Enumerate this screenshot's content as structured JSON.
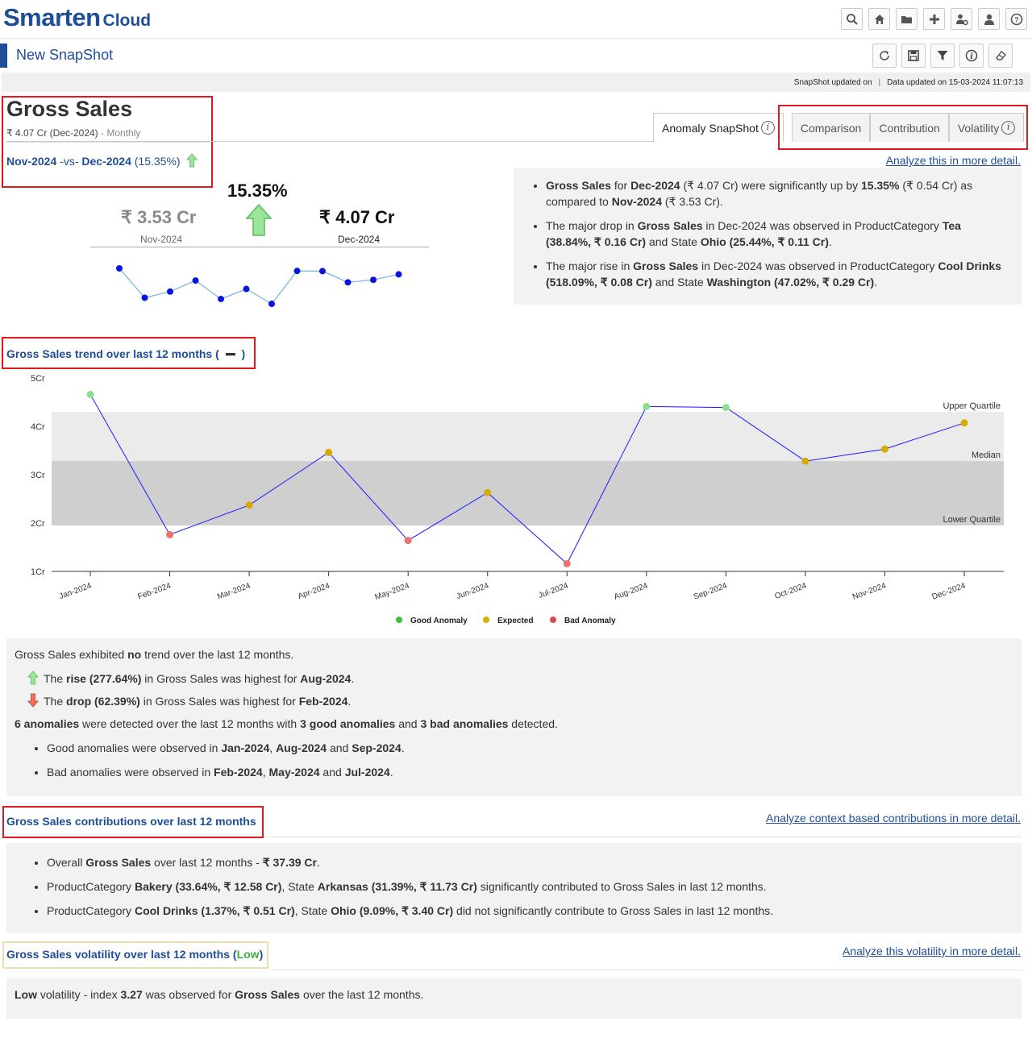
{
  "app": {
    "logo_main": "Smarten",
    "logo_sub": "Cloud"
  },
  "top_icons": [
    "search-icon",
    "home-icon",
    "folder-icon",
    "plus-icon",
    "user-settings-icon",
    "user-icon",
    "help-icon"
  ],
  "page": {
    "title": "New SnapShot"
  },
  "sub_icons": [
    "refresh-icon",
    "save-icon",
    "filter-icon",
    "info-icon",
    "eraser-icon"
  ],
  "status": {
    "snapshot_label": "SnapShot updated on",
    "separator": "|",
    "data_label": "Data updated on 15-03-2024 11:07:13"
  },
  "measure": {
    "title": "Gross Sales",
    "current_value": "₹ 4.07 Cr (Dec-2024)",
    "frequency": "- Monthly",
    "compare_prev": "Nov-2024",
    "compare_vs": "-vs-",
    "compare_cur": "Dec-2024",
    "compare_pct": "(15.35%)"
  },
  "tabs": [
    {
      "label": "Anomaly SnapShot",
      "active": true,
      "info": "i"
    },
    {
      "label": "Comparison",
      "active": false
    },
    {
      "label": "Contribution",
      "active": false
    },
    {
      "label": "Volatility",
      "active": false,
      "info": "i"
    }
  ],
  "links": {
    "analyze_detail": "Analyze this in more detail.",
    "analyze_contrib": "Analyze context based contributions in more detail.",
    "analyze_vol": "Analyze this volatility in more detail."
  },
  "kpi": {
    "pct": "15.35%",
    "prev_value": "₹ 3.53 Cr",
    "prev_label": "Nov-2024",
    "cur_value": "₹ 4.07 Cr",
    "cur_label": "Dec-2024",
    "sparkline": [
      4.66,
      1.76,
      2.37,
      3.46,
      1.64,
      2.63,
      1.16,
      4.41,
      4.39,
      3.28,
      3.53,
      4.07
    ]
  },
  "summary": {
    "b1": {
      "a": "Gross Sales",
      "b": " for ",
      "c": "Dec-2024",
      "d": " (₹ 4.07 Cr) were significantly up by ",
      "e": "15.35%",
      "f": " (₹ 0.54 Cr) as compared to ",
      "g": "Nov-2024",
      "h": " (₹ 3.53 Cr)."
    },
    "b2": {
      "a": "The major drop in ",
      "b": "Gross Sales",
      "c": " in Dec-2024 was observed in ProductCategory ",
      "d": "Tea (38.84%, ₹ 0.16 Cr)",
      "e": " and State ",
      "f": "Ohio (25.44%, ₹ 0.11 Cr)",
      "g": "."
    },
    "b3": {
      "a": "The major rise in ",
      "b": "Gross Sales",
      "c": " in Dec-2024 was observed in ProductCategory ",
      "d": "Cool Drinks (518.09%, ₹ 0.08 Cr)",
      "e": " and State ",
      "f": "Washington (47.02%, ₹ 0.29 Cr)",
      "g": "."
    }
  },
  "trend_section": {
    "title": "Gross Sales trend over last 12 months (",
    "title_end": ")"
  },
  "chart_data": {
    "type": "line",
    "categories": [
      "Jan-2024",
      "Feb-2024",
      "Mar-2024",
      "Apr-2024",
      "May-2024",
      "Jun-2024",
      "Jul-2024",
      "Aug-2024",
      "Sep-2024",
      "Oct-2024",
      "Nov-2024",
      "Dec-2024"
    ],
    "values": [
      4.66,
      1.76,
      2.37,
      3.46,
      1.64,
      2.63,
      1.16,
      4.41,
      4.39,
      3.28,
      3.53,
      4.07
    ],
    "point_class": [
      "good",
      "bad",
      "expected",
      "expected",
      "bad",
      "expected",
      "bad",
      "good",
      "good",
      "expected",
      "expected",
      "expected"
    ],
    "y_ticks": [
      "1Cr",
      "2Cr",
      "3Cr",
      "4Cr",
      "5Cr"
    ],
    "ylim": [
      1,
      5
    ],
    "bands": {
      "upper_quartile": 4.3,
      "median": 3.28,
      "lower_quartile": 1.95
    },
    "band_labels": {
      "upper": "Upper Quartile",
      "median": "Median",
      "lower": "Lower Quartile"
    },
    "legend": [
      {
        "name": "Good Anomaly",
        "color": "#3cc13c"
      },
      {
        "name": "Expected",
        "color": "#d9aa00"
      },
      {
        "name": "Bad Anomaly",
        "color": "#e04848"
      }
    ],
    "colors": {
      "line": "#1a1aff",
      "good": "#8be08b",
      "expected": "#d9aa00",
      "bad": "#f07070",
      "band_outer": "#ebebeb",
      "band_inner": "#cfcfcf"
    }
  },
  "trend_summary": {
    "l1a": "Gross Sales exhibited ",
    "l1b": "no",
    "l1c": " trend over the last 12 months.",
    "l2a": "The ",
    "l2b": "rise (277.64%)",
    "l2c": " in Gross Sales was highest for ",
    "l2d": "Aug-2024",
    "l2e": ".",
    "l3a": "The ",
    "l3b": "drop (62.39%)",
    "l3c": " in Gross Sales was highest for ",
    "l3d": "Feb-2024",
    "l3e": ".",
    "l4a": "6 anomalies",
    "l4b": " were detected over the last 12 months with ",
    "l4c": "3 good anomalies",
    "l4d": " and ",
    "l4e": "3 bad anomalies",
    "l4f": " detected.",
    "g1": "Good anomalies were observed in ",
    "g2": "Jan-2024",
    "g3": ", ",
    "g4": "Aug-2024",
    "g5": " and ",
    "g6": "Sep-2024",
    "g7": ".",
    "b1": "Bad anomalies were observed in ",
    "b2": "Feb-2024",
    "b3": ", ",
    "b4": "May-2024",
    "b5": " and ",
    "b6": "Jul-2024",
    "b7": "."
  },
  "contrib_section": {
    "title": "Gross Sales contributions over last 12 months"
  },
  "contrib": {
    "c1a": "Overall ",
    "c1b": "Gross Sales",
    "c1c": " over last 12 months - ",
    "c1d": "₹ 37.39 Cr",
    "c1e": ".",
    "c2a": "ProductCategory ",
    "c2b": "Bakery (33.64%, ₹ 12.58 Cr)",
    "c2c": ", State ",
    "c2d": "Arkansas (31.39%, ₹ 11.73 Cr)",
    "c2e": " significantly contributed to Gross Sales in last 12 months.",
    "c3a": "ProductCategory ",
    "c3b": "Cool Drinks (1.37%, ₹ 0.51 Cr)",
    "c3c": ", State ",
    "c3d": "Ohio (9.09%, ₹ 3.40 Cr)",
    "c3e": " did not significantly contribute to Gross Sales in last 12 months."
  },
  "vol_section": {
    "title": "Gross Sales volatility over last 12 months (",
    "level": "Low",
    "title_end": ")"
  },
  "vol": {
    "a": "Low",
    "b": " volatility - index ",
    "c": "3.27",
    "d": " was observed for ",
    "e": "Gross Sales",
    "f": " over the last 12 months."
  }
}
